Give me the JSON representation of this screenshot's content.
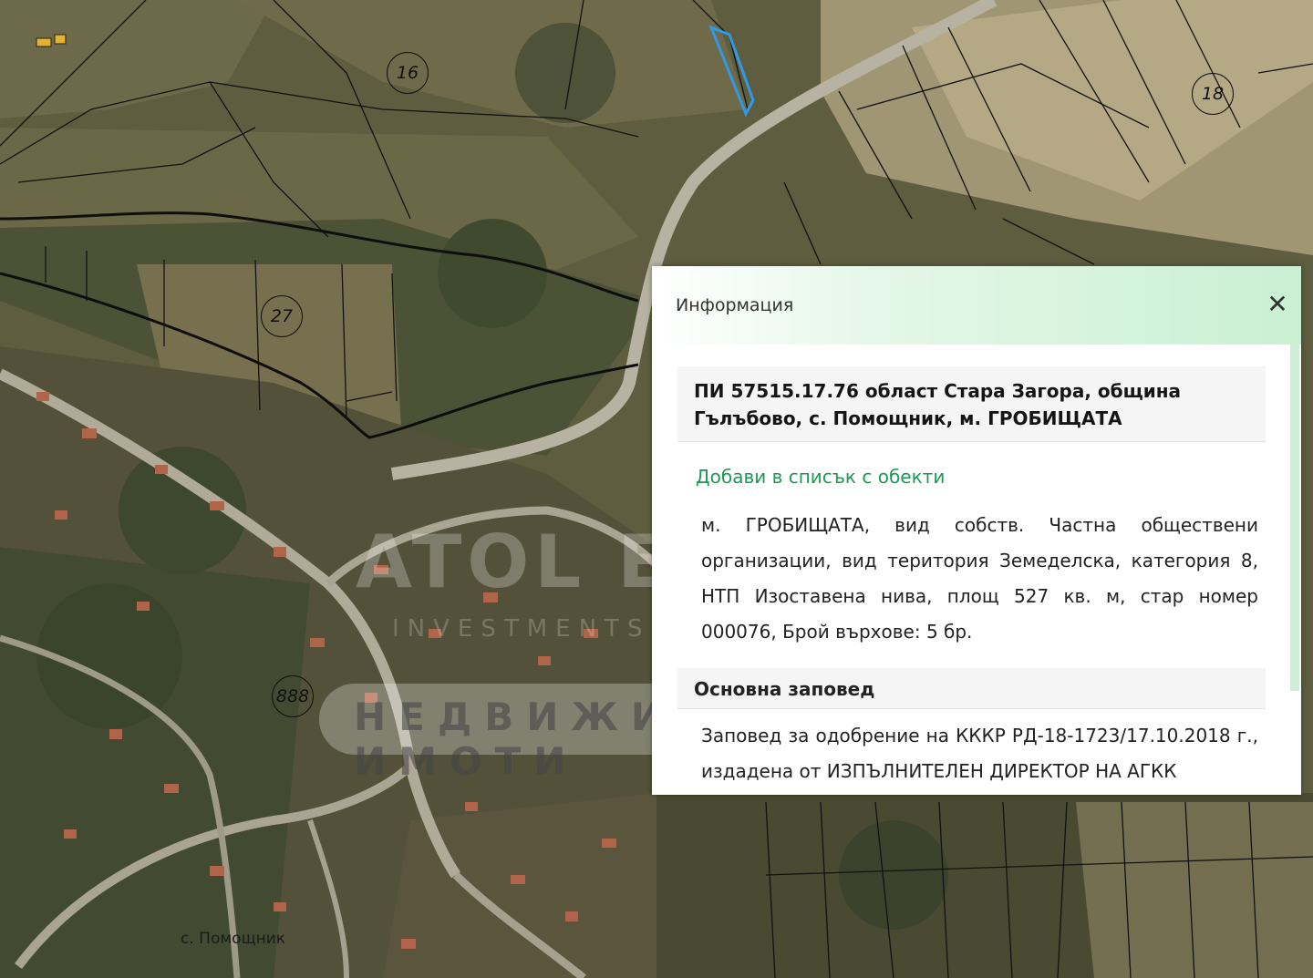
{
  "map": {
    "parcel_numbers": [
      "16",
      "18",
      "27",
      "888"
    ],
    "village_label": "с. Помощник"
  },
  "watermark": {
    "title": "ATOL ESTATE",
    "subtitle": "INVESTMENTS AND SALES",
    "pill_text": "НЕДВИЖИМИ ИМОТИ"
  },
  "popup": {
    "title": "Информация",
    "close_icon": "close-icon",
    "heading": "ПИ 57515.17.76 област Стара Загора, община Гълъбово, с. Помощник, м. ГРОБИЩАТА",
    "add_link": "Добави в списък с обекти",
    "description": "м. ГРОБИЩАТА, вид собств. Частна обществени организации, вид територия Земеделска, категория 8, НТП Изоставена нива, площ 527 кв. м, стар номер 000076, Брой върхове: 5 бр.",
    "section_title": "Основна заповед",
    "order_text": "Заповед за одобрение на КККР РД-18-1723/17.10.2018 г., издадена от ИЗПЪЛНИТЕЛЕН ДИРЕКТОР НА АГКК"
  },
  "colors": {
    "link": "#1c9a55",
    "highlight_parcel": "#2e9bea",
    "header_gradient_end": "#c9f0d2"
  }
}
